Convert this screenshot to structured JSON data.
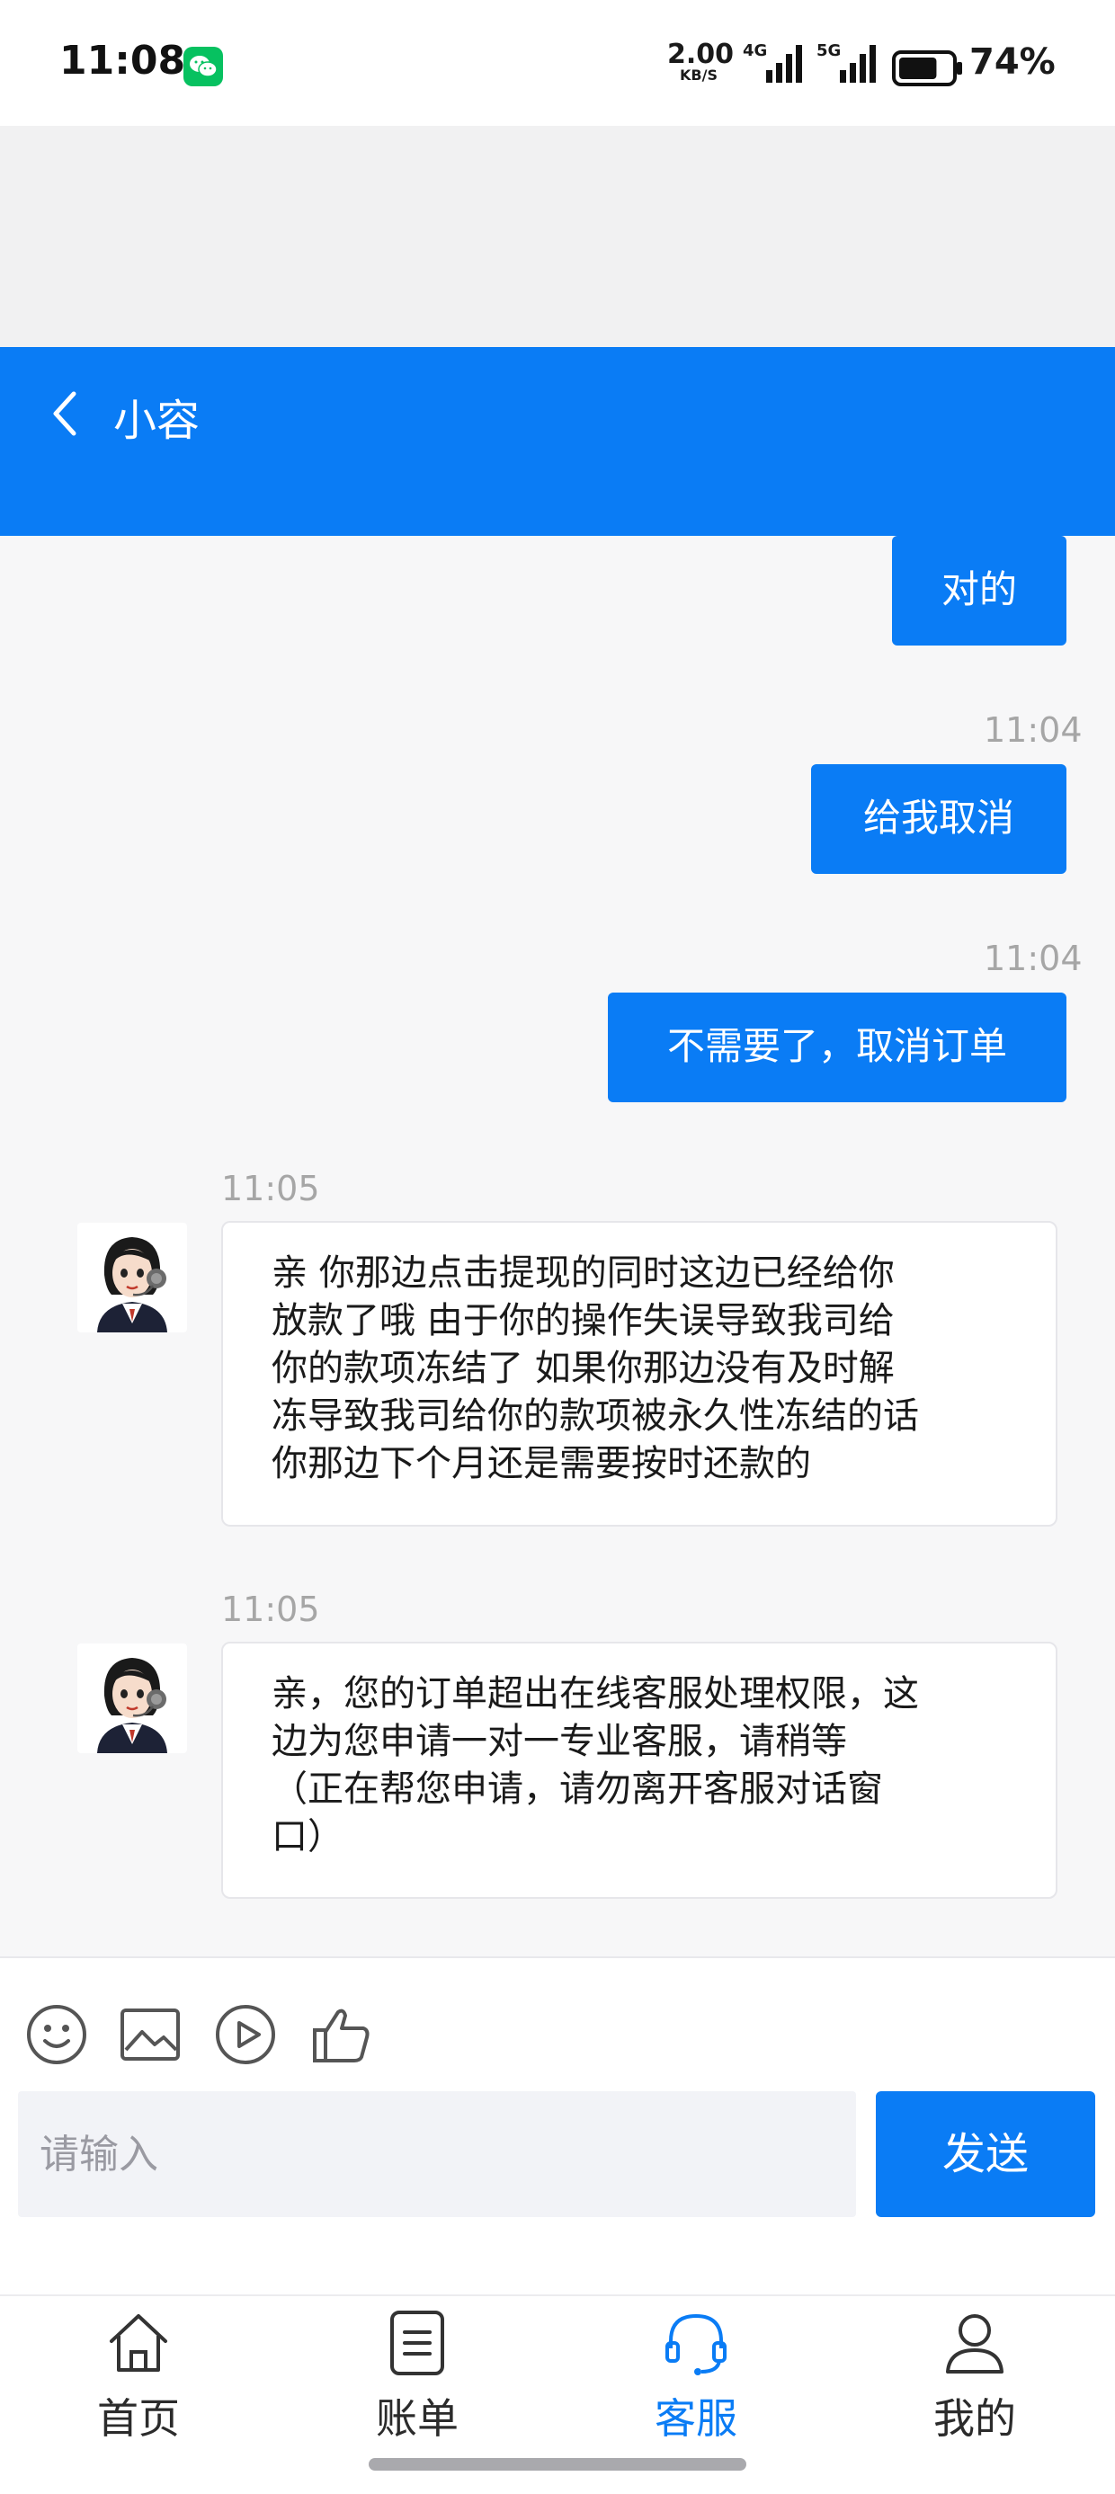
{
  "status_bar": {
    "time": "11:08",
    "net_speed_value": "2.00",
    "net_speed_unit": "KB/S",
    "sim1_label": "4G",
    "sim2_label": "5G",
    "battery_percent": "74%",
    "battery_level": 0.74
  },
  "header": {
    "title": "小容"
  },
  "messages": {
    "m1": {
      "sender": "me",
      "text": "对的"
    },
    "m2": {
      "sender": "me",
      "time": "11:04",
      "text": "给我取消"
    },
    "m3": {
      "sender": "me",
      "time": "11:04",
      "text": "不需要了，取消订单"
    },
    "m4": {
      "sender": "agent",
      "time": "11:05",
      "text": "亲 你那边点击提现的同时这边已经给你\n放款了哦 由于你的操作失误导致我司给\n你的款项冻结了 如果你那边没有及时解\n冻导致我司给你的款项被永久性冻结的话\n你那边下个月还是需要按时还款的"
    },
    "m5": {
      "sender": "agent",
      "time": "11:05",
      "text": "亲，您的订单超出在线客服处理权限，这\n边为您申请一对一专业客服，请稍等\n（正在帮您申请，请勿离开客服对话窗\n口）"
    }
  },
  "composer": {
    "placeholder": "请输入",
    "send_label": "发送",
    "tools": [
      "emoji-icon",
      "image-icon",
      "video-icon",
      "thumbs-up-icon"
    ]
  },
  "tabbar": {
    "items": [
      {
        "label": "首页",
        "icon": "home-icon"
      },
      {
        "label": "账单",
        "icon": "bill-icon"
      },
      {
        "label": "客服",
        "icon": "headset-icon",
        "active": true
      },
      {
        "label": "我的",
        "icon": "user-icon"
      }
    ]
  },
  "colors": {
    "accent": "#0a7cf5",
    "wechat": "#07c160"
  }
}
